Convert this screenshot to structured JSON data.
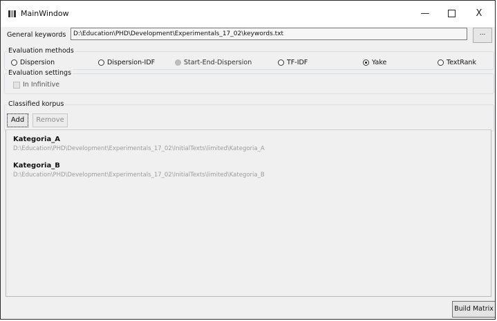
{
  "window": {
    "title": "MainWindow",
    "minimize": "—",
    "maximize": "□",
    "close": "X"
  },
  "keywords": {
    "label": "General keywords",
    "value": "D:\\Education\\PHD\\Development\\Experimentals_17_02\\keywords.txt",
    "browse": "..."
  },
  "methods": {
    "legend": "Evaluation methods",
    "options": [
      {
        "label": "Dispersion",
        "state": "unchecked"
      },
      {
        "label": "Dispersion-IDF",
        "state": "unchecked"
      },
      {
        "label": "Start-End-Dispersion",
        "state": "disabled"
      },
      {
        "label": "TF-IDF",
        "state": "unchecked"
      },
      {
        "label": "Yake",
        "state": "checked"
      },
      {
        "label": "TextRank",
        "state": "unchecked"
      }
    ]
  },
  "settings": {
    "legend": "Evaluation settings",
    "checkbox_label": "In Infinitive"
  },
  "korpus": {
    "legend": "Classified korpus",
    "add": "Add",
    "remove": "Remove",
    "items": [
      {
        "name": "Kategoria_A",
        "path": "D:\\Education\\PHD\\Development\\Experimentals_17_02\\InitialTexts\\limited\\Kategoria_A"
      },
      {
        "name": "Kategoria_B",
        "path": "D:\\Education\\PHD\\Development\\Experimentals_17_02\\InitialTexts\\limited\\Kategoria_B"
      }
    ]
  },
  "build_button": "Build Matrix"
}
